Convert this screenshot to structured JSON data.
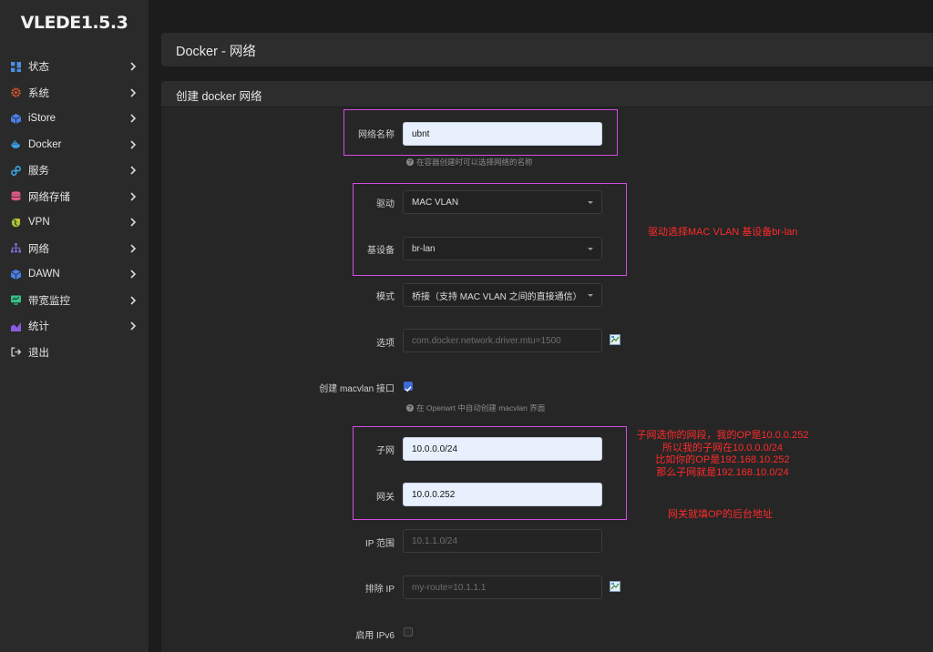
{
  "brand": "VLEDE1.5.3",
  "nav": [
    {
      "label": "状态",
      "icon": "dashboard-icon",
      "color": "#4a90e2"
    },
    {
      "label": "系统",
      "icon": "gear-icon",
      "color": "#e05a2b"
    },
    {
      "label": "iStore",
      "icon": "cube-icon",
      "color": "#4a7fe8"
    },
    {
      "label": "Docker",
      "icon": "docker-whale-icon",
      "color": "#3da0e8"
    },
    {
      "label": "服务",
      "icon": "link-icon",
      "color": "#37a3e0"
    },
    {
      "label": "网络存储",
      "icon": "database-icon",
      "color": "#e05a8a"
    },
    {
      "label": "VPN",
      "icon": "globe-icon",
      "color": "#a3c437"
    },
    {
      "label": "网络",
      "icon": "network-tree-icon",
      "color": "#8a6ae0"
    },
    {
      "label": "DAWN",
      "icon": "cube-icon",
      "color": "#4a7fe8"
    },
    {
      "label": "带宽监控",
      "icon": "monitor-icon",
      "color": "#36c38a"
    },
    {
      "label": "统计",
      "icon": "chart-icon",
      "color": "#8a5ae0"
    },
    {
      "label": "退出",
      "icon": "logout-icon",
      "color": "#cfcfcf"
    }
  ],
  "page_title": "Docker - 网络",
  "section_title": "创建 docker 网络",
  "form": {
    "network_name_label": "网络名称",
    "network_name_value": "ubnt",
    "network_name_hint": "在容器创建时可以选择网络的名称",
    "driver_label": "驱动",
    "driver_value": "MAC VLAN",
    "parent_label": "基设备",
    "parent_value": "br-lan",
    "mode_label": "模式",
    "mode_value": "桥接（支持 MAC VLAN 之间的直接通信）",
    "options_label": "选项",
    "options_placeholder": "com.docker.network.driver.mtu=1500",
    "create_macvlan_label": "创建 macvlan 接口",
    "create_macvlan_checked": true,
    "create_macvlan_hint": "在 Openwrt 中自动创建 macvlan 界面",
    "subnet_label": "子网",
    "subnet_value": "10.0.0.0/24",
    "gateway_label": "网关",
    "gateway_value": "10.0.0.252",
    "ip_range_label": "IP 范围",
    "ip_range_placeholder": "10.1.1.0/24",
    "exclude_ip_label": "排除 IP",
    "exclude_ip_placeholder": "my-route=10.1.1.1",
    "ipv6_label": "启用 IPv6",
    "ipv6_checked": false
  },
  "annotations": {
    "driver_note": "驱动选择MAC VLAN   基设备br-lan",
    "subnet_note_lines": [
      "子网选你的网段，我的OP是10.0.0.252",
      "所以我的子网在10.0.0.0/24",
      "比如你的OP是192.168.10.252",
      "那么子网就是192.168.10.0/24"
    ],
    "gateway_note": "网关就填OP的后台地址"
  },
  "colors": {
    "highlight_box": "#d24de0",
    "annotation_text": "#ff2a2a",
    "checkbox_checked": "#3d6ad6"
  }
}
